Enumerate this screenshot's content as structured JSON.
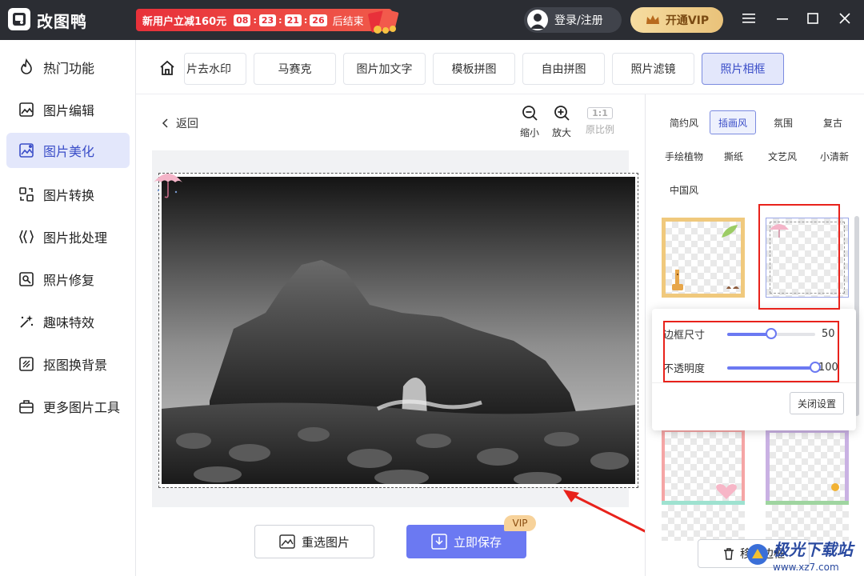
{
  "app": {
    "title": "改图鸭"
  },
  "promo": {
    "text": "新用户立减160元",
    "h": "08",
    "m": "23",
    "s": "21",
    "ms": "26",
    "suffix": "后结束"
  },
  "header": {
    "login": "登录/注册",
    "vip": "开通VIP"
  },
  "sidebar": {
    "items": [
      {
        "label": "热门功能",
        "icon": "fire-icon"
      },
      {
        "label": "图片编辑",
        "icon": "image-edit-icon"
      },
      {
        "label": "图片美化",
        "icon": "image-beautify-icon"
      },
      {
        "label": "图片转换",
        "icon": "convert-icon"
      },
      {
        "label": "图片批处理",
        "icon": "batch-icon"
      },
      {
        "label": "照片修复",
        "icon": "repair-icon"
      },
      {
        "label": "趣味特效",
        "icon": "sparkle-icon"
      },
      {
        "label": "抠图换背景",
        "icon": "cutout-icon"
      },
      {
        "label": "更多图片工具",
        "icon": "toolbox-icon"
      }
    ]
  },
  "tabs": [
    "片去水印",
    "马赛克",
    "图片加文字",
    "模板拼图",
    "自由拼图",
    "照片滤镜",
    "照片相框"
  ],
  "canvas": {
    "back": "返回",
    "zoom_out": "缩小",
    "zoom_in": "放大",
    "ratio": "1:1",
    "ratio_label": "原比例",
    "reselect": "重选图片",
    "save": "立即保存",
    "vip": "VIP"
  },
  "styles": [
    "简约风",
    "插画风",
    "氛围",
    "复古",
    "手绘植物",
    "撕纸",
    "文艺风",
    "小清新",
    "中国风"
  ],
  "settings": {
    "border_size_label": "边框尺寸",
    "border_size": 50,
    "opacity_label": "不透明度",
    "opacity": 100,
    "close": "关闭设置"
  },
  "remove_frame": "移除边框",
  "watermark": {
    "text": "极光下载站",
    "url": "www.xz7.com"
  },
  "colors": {
    "accent": "#6b79f2",
    "active_bg": "#e3e7fb",
    "titlebar": "#2b2d33",
    "highlight": "#e8221b"
  }
}
